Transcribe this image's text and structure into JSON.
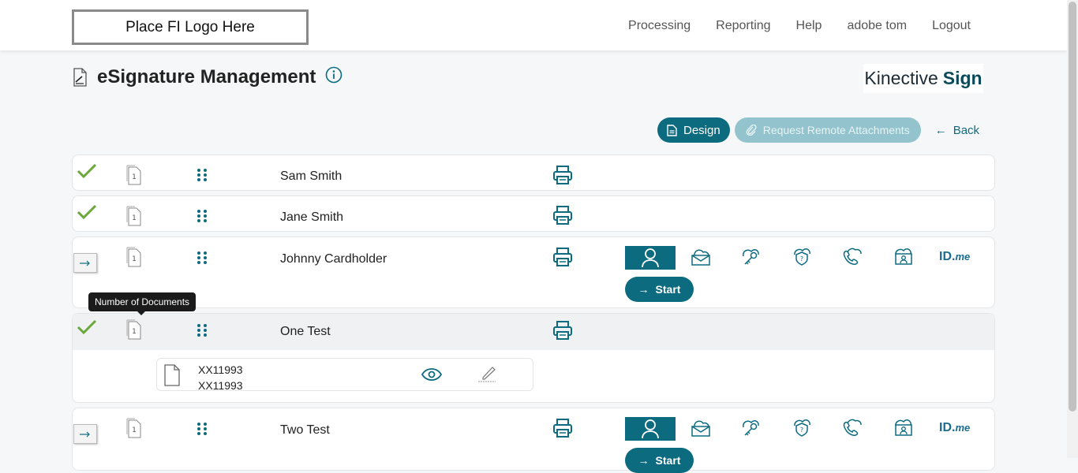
{
  "header": {
    "logo_text": "Place FI Logo Here",
    "nav": [
      "Processing",
      "Reporting",
      "Help",
      "adobe tom",
      "Logout"
    ]
  },
  "page": {
    "title": "eSignature Management",
    "brand_light": "Kinective",
    "brand_bold": "Sign"
  },
  "actions": {
    "design": "Design",
    "remote": "Request Remote Attachments",
    "back": "Back"
  },
  "tooltip": "Number of Documents",
  "signers": [
    {
      "name": "Sam Smith",
      "doc_count": "1",
      "status": "complete"
    },
    {
      "name": "Jane Smith",
      "doc_count": "1",
      "status": "complete"
    },
    {
      "name": "Johnny Cardholder",
      "doc_count": "1",
      "status": "pending",
      "start_label": "Start"
    },
    {
      "name": "One Test",
      "doc_count": "1",
      "status": "complete",
      "documents": [
        {
          "line1": "XX11993",
          "line2": "XX11993"
        }
      ]
    },
    {
      "name": "Two Test",
      "doc_count": "1",
      "status": "pending",
      "start_label": "Start"
    }
  ],
  "auth": {
    "idme_main": "ID.",
    "idme_suffix": "me"
  },
  "colors": {
    "accent": "#0d6b80",
    "check": "#6aa83a",
    "accent_muted": "#93c4cd"
  }
}
